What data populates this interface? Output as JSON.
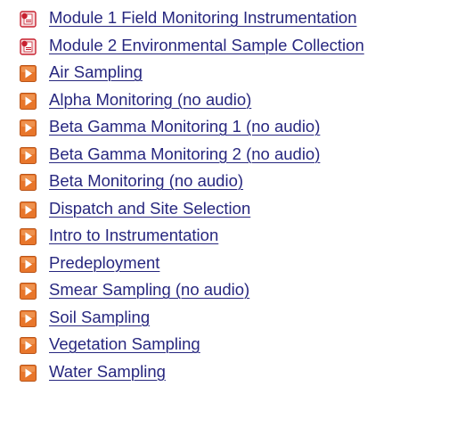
{
  "colors": {
    "link": "#27277f",
    "video_icon": "#e8762b",
    "document_icon": "#c8202f"
  },
  "items": [
    {
      "label": "Module 1 Field Monitoring Instrumentation",
      "icon": "document-icon"
    },
    {
      "label": "Module 2 Environmental Sample Collection",
      "icon": "document-icon"
    },
    {
      "label": "Air Sampling",
      "icon": "video-play-icon"
    },
    {
      "label": "Alpha Monitoring (no audio)",
      "icon": "video-play-icon"
    },
    {
      "label": "Beta Gamma Monitoring 1 (no audio)",
      "icon": "video-play-icon"
    },
    {
      "label": "Beta Gamma Monitoring 2 (no audio)",
      "icon": "video-play-icon"
    },
    {
      "label": "Beta Monitoring (no audio)",
      "icon": "video-play-icon"
    },
    {
      "label": "Dispatch and Site Selection",
      "icon": "video-play-icon"
    },
    {
      "label": "Intro to Instrumentation",
      "icon": "video-play-icon"
    },
    {
      "label": "Predeployment",
      "icon": "video-play-icon"
    },
    {
      "label": "Smear Sampling (no audio)",
      "icon": "video-play-icon"
    },
    {
      "label": "Soil Sampling",
      "icon": "video-play-icon"
    },
    {
      "label": "Vegetation Sampling",
      "icon": "video-play-icon"
    },
    {
      "label": "Water Sampling",
      "icon": "video-play-icon"
    }
  ]
}
